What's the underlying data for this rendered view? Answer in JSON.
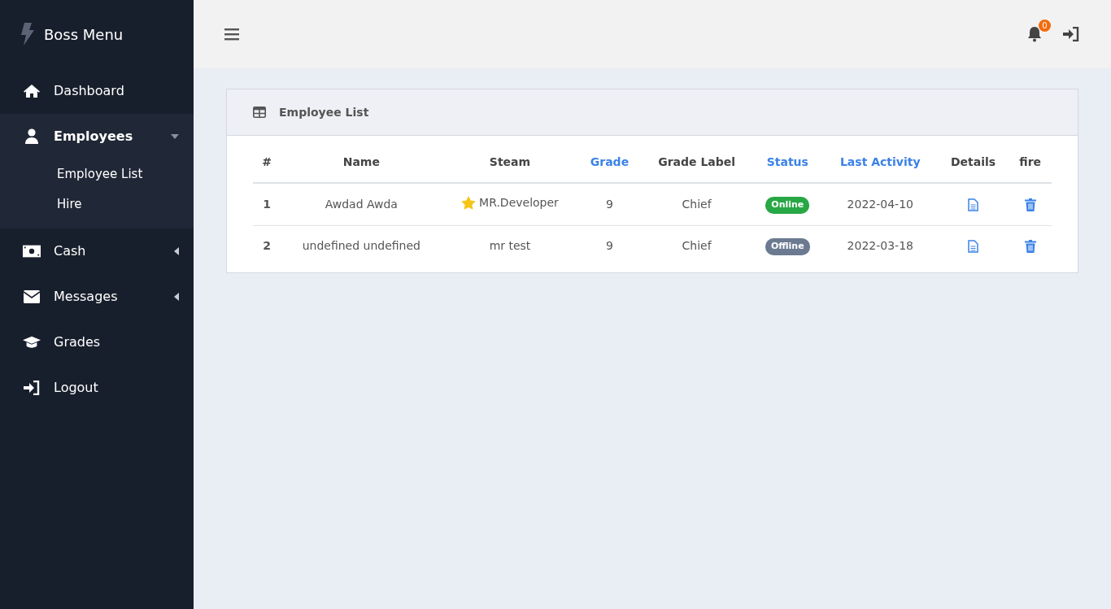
{
  "brand": {
    "title": "Boss Menu"
  },
  "sidebar": {
    "items": [
      {
        "label": "Dashboard",
        "selected": false
      },
      {
        "label": "Employees",
        "selected": true,
        "expanded": true,
        "children": [
          {
            "label": "Employee List"
          },
          {
            "label": "Hire"
          }
        ]
      },
      {
        "label": "Cash",
        "selected": false,
        "expanded": false
      },
      {
        "label": "Messages",
        "selected": false,
        "expanded": false
      },
      {
        "label": "Grades",
        "selected": false
      },
      {
        "label": "Logout",
        "selected": false
      }
    ]
  },
  "topbar": {
    "notification_count": "0"
  },
  "card": {
    "title": "Employee List"
  },
  "table": {
    "columns": [
      {
        "label": "#",
        "sortable": false
      },
      {
        "label": "Name",
        "sortable": false
      },
      {
        "label": "Steam",
        "sortable": false
      },
      {
        "label": "Grade",
        "sortable": true
      },
      {
        "label": "Grade Label",
        "sortable": false
      },
      {
        "label": "Status",
        "sortable": true
      },
      {
        "label": "Last Activity",
        "sortable": true
      },
      {
        "label": "Details",
        "sortable": false
      },
      {
        "label": "fire",
        "sortable": false
      }
    ],
    "rows": [
      {
        "number": "1",
        "name": "Awdad Awda",
        "steam": "MR.Developer",
        "starred": true,
        "grade": "9",
        "grade_label": "Chief",
        "status": {
          "label": "Online",
          "color": "#28a745"
        },
        "last_activity": "2022-04-10"
      },
      {
        "number": "2",
        "name": "undefined undefined",
        "steam": "mr test",
        "starred": false,
        "grade": "9",
        "grade_label": "Chief",
        "status": {
          "label": "Offline",
          "color": "#6c7a91"
        },
        "last_activity": "2022-03-18"
      }
    ]
  }
}
